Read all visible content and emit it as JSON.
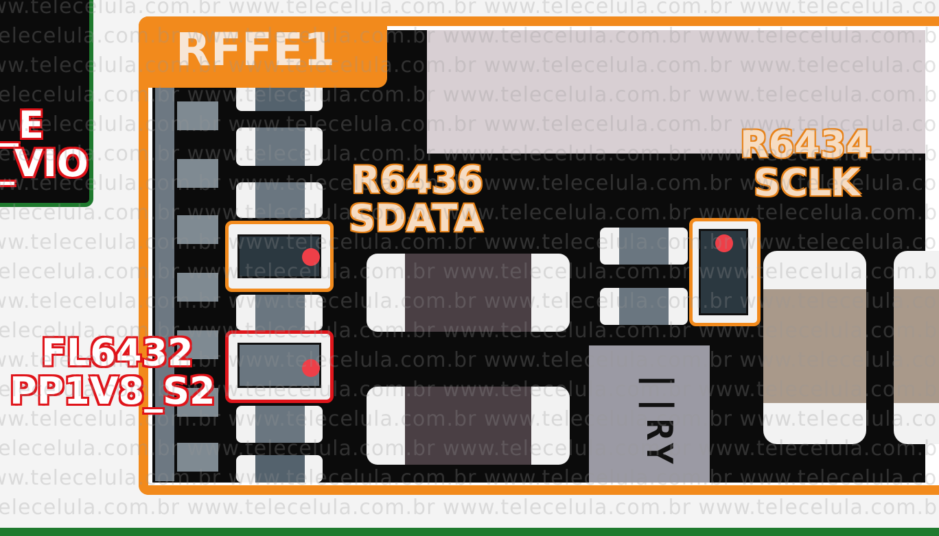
{
  "region": {
    "title": "RFFE1",
    "accent_color": "#f28a1c"
  },
  "labels": {
    "left_top": {
      "line1": "_E",
      "line2": "_VIO",
      "color": "#e0151b"
    },
    "fl6432": {
      "ref": "FL6432",
      "net": "PP1V8_S2",
      "color": "#e0151b"
    },
    "r6436": {
      "ref": "R6436",
      "net": "SDATA",
      "color": "#f28a1c"
    },
    "r6434": {
      "ref": "R6434",
      "net": "SCLK",
      "color": "#f28a1c"
    }
  },
  "chip_marking": "||RY",
  "watermark": "www.telecelula.com.br",
  "colors": {
    "board": "#0b0b0b",
    "silk_pink": "#d8cfd3",
    "left_frame": "#1f7a2e"
  }
}
